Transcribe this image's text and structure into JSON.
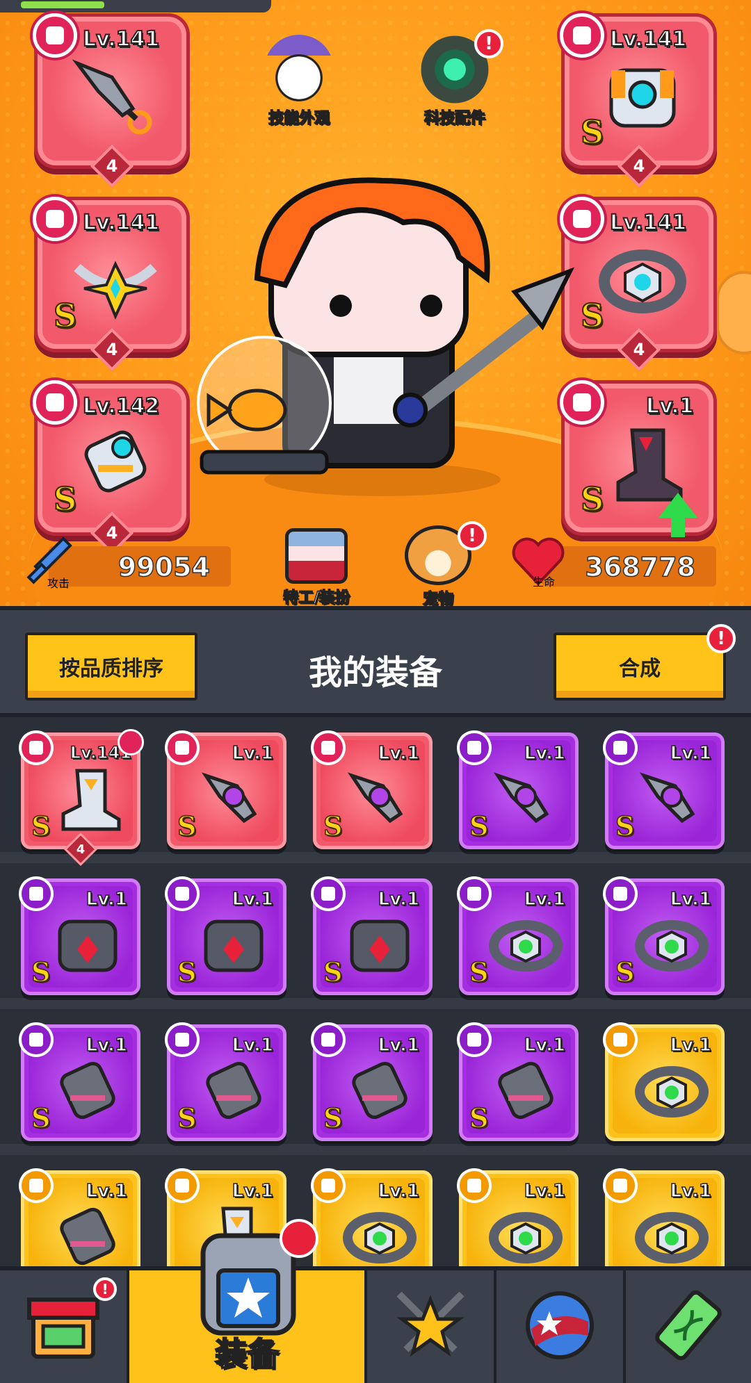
{
  "hero": {
    "equipped": [
      {
        "slot": "weapon",
        "level": "Lv.141",
        "stars": "4",
        "rarity": "",
        "type_icon": "kunai-icon"
      },
      {
        "slot": "armor",
        "level": "Lv.141",
        "stars": "4",
        "rarity": "S",
        "type_icon": "shirt-icon"
      },
      {
        "slot": "necklace",
        "level": "Lv.141",
        "stars": "4",
        "rarity": "S",
        "type_icon": "necklace-icon"
      },
      {
        "slot": "belt",
        "level": "Lv.141",
        "stars": "4",
        "rarity": "S",
        "type_icon": "belt-icon"
      },
      {
        "slot": "gloves",
        "level": "Lv.142",
        "stars": "4",
        "rarity": "S",
        "type_icon": "glove-icon"
      },
      {
        "slot": "boots",
        "level": "Lv.1",
        "stars": "",
        "rarity": "S",
        "type_icon": "boot-icon"
      }
    ],
    "buttons": {
      "skill_skin": "技能外观",
      "tech_parts": "科技配件",
      "agent_outfit": "特工/装扮",
      "pet": "宠物"
    },
    "alert_glyph": "!",
    "attack": {
      "label": "攻击",
      "value": "99054"
    },
    "hp": {
      "label": "生命",
      "value": "368778"
    }
  },
  "equipment": {
    "sort_button": "按品质排序",
    "title": "我的装备",
    "merge_button": "合成",
    "items": [
      {
        "level": "Lv.141",
        "rarity": "S",
        "quality": "red",
        "type": "boot",
        "stars": "4",
        "equipped": true
      },
      {
        "level": "Lv.1",
        "rarity": "S",
        "quality": "red",
        "type": "kunai"
      },
      {
        "level": "Lv.1",
        "rarity": "S",
        "quality": "red",
        "type": "kunai"
      },
      {
        "level": "Lv.1",
        "rarity": "S",
        "quality": "purple",
        "type": "kunai"
      },
      {
        "level": "Lv.1",
        "rarity": "S",
        "quality": "purple",
        "type": "kunai"
      },
      {
        "level": "Lv.1",
        "rarity": "S",
        "quality": "purple",
        "type": "shirt"
      },
      {
        "level": "Lv.1",
        "rarity": "S",
        "quality": "purple",
        "type": "shirt"
      },
      {
        "level": "Lv.1",
        "rarity": "S",
        "quality": "purple",
        "type": "shirt"
      },
      {
        "level": "Lv.1",
        "rarity": "S",
        "quality": "purple",
        "type": "belt"
      },
      {
        "level": "Lv.1",
        "rarity": "S",
        "quality": "purple",
        "type": "belt"
      },
      {
        "level": "Lv.1",
        "rarity": "S",
        "quality": "purple",
        "type": "glove"
      },
      {
        "level": "Lv.1",
        "rarity": "S",
        "quality": "purple",
        "type": "glove"
      },
      {
        "level": "Lv.1",
        "rarity": "S",
        "quality": "purple",
        "type": "glove"
      },
      {
        "level": "Lv.1",
        "rarity": "S",
        "quality": "purple",
        "type": "glove"
      },
      {
        "level": "Lv.1",
        "rarity": "",
        "quality": "gold",
        "type": "belt"
      },
      {
        "level": "Lv.1",
        "rarity": "",
        "quality": "gold",
        "type": "glove"
      },
      {
        "level": "Lv.1",
        "rarity": "",
        "quality": "gold",
        "type": "boot"
      },
      {
        "level": "Lv.1",
        "rarity": "",
        "quality": "gold",
        "type": "belt"
      },
      {
        "level": "Lv.1",
        "rarity": "",
        "quality": "gold",
        "type": "belt"
      },
      {
        "level": "Lv.1",
        "rarity": "",
        "quality": "gold",
        "type": "belt"
      }
    ]
  },
  "nav": {
    "tabs": [
      {
        "name": "shop",
        "label": "",
        "icon": "shop-icon",
        "alert": true
      },
      {
        "name": "equipment",
        "label": "装备",
        "icon": "equipment-icon",
        "active": true
      },
      {
        "name": "skills",
        "label": "",
        "icon": "star-swords-icon"
      },
      {
        "name": "planet",
        "label": "",
        "icon": "planet-icon"
      },
      {
        "name": "gene",
        "label": "",
        "icon": "dna-icon"
      }
    ]
  },
  "colors": {
    "hero_bg": "#ff9a1a",
    "panel": "#3b414c",
    "accent_gold": "#ffc319",
    "red_quality": "#f25a6b",
    "purple_quality": "#a52ee0",
    "gold_quality": "#ffc21a"
  }
}
